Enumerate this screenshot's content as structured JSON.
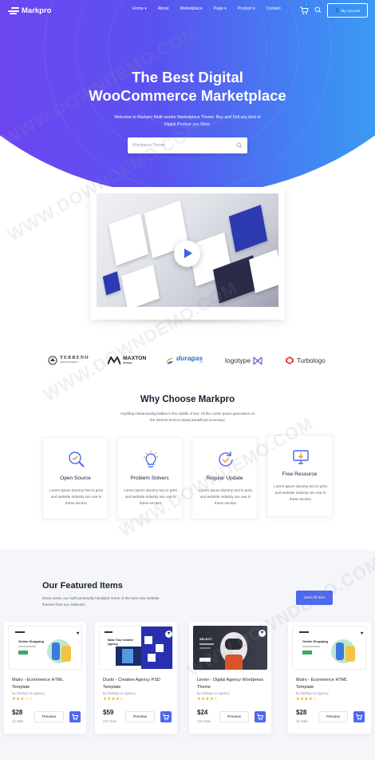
{
  "nav": {
    "logo": "Markpro",
    "menu": [
      "Home",
      "About",
      "Marketplace",
      "Page",
      "Product",
      "Contact"
    ],
    "cart_count": "0",
    "account_label": "My Account"
  },
  "hero": {
    "title_line1": "The Best Digital",
    "title_line2": "WooCommerce Marketplace",
    "subtitle": "Welcome to Markpro Multi vendor Marketplace Theme. Buy and Sell any kind of Digital Product you Wish.",
    "search_placeholder": "Wordpress Theme"
  },
  "brands": [
    "TERRENO",
    "MAXTON",
    "duragas",
    "logotype",
    "Turbologo"
  ],
  "brand_sub": {
    "terreno": "CREATIVE AGENCY",
    "maxton": "design",
    "duragas": "CO"
  },
  "why": {
    "title": "Why Choose Markpro",
    "subtitle": "Anything embarrassing hidden in the middle of text. All the Lorem Ipsum generators on the Internet tend to repeat predefined necessary",
    "features": [
      {
        "title": "Open Source",
        "icon": "search-check-icon",
        "desc": "Lorem ipsum dummy text in print and website industry are use in these section"
      },
      {
        "title": "Problem Solvers",
        "icon": "lightbulb-icon",
        "desc": "Lorem ipsum dummy text in print and website industry are use in these section"
      },
      {
        "title": "Regular Update",
        "icon": "refresh-check-icon",
        "desc": "Lorem ipsum dummy text in print and website industry are use in these section"
      },
      {
        "title": "Free Resource",
        "icon": "monitor-icon",
        "desc": "Lorem ipsum dummy text in print and website industry are use in these section"
      }
    ]
  },
  "featured": {
    "title": "Our Featured Items",
    "subtitle": "Every week, our staff personally handpick some of the best new website themes from our collection",
    "view_all": "View All Item",
    "items": [
      {
        "name": "Malro - Ecommerce HTML Template",
        "by": "by DivDojo in Agency",
        "stars": "★★★☆☆",
        "price": "$28",
        "sales": "12 Sale",
        "preview": "Preview",
        "thumb_title": "Online Shopping"
      },
      {
        "name": "Duxlo - Creative Agency PSD Template",
        "by": "by DivDojo in Agency",
        "stars": "★★★★☆",
        "price": "$59",
        "sales": "247 Sale",
        "preview": "Preview",
        "thumb_title": "Make Your Creative Agency"
      },
      {
        "name": "Linner - Digital Agency Wordpress Theme",
        "by": "by DivDojo in Agency",
        "stars": "★★★★☆",
        "price": "$24",
        "sales": "124 Sale",
        "preview": "Preview",
        "thumb_title": "SELECT"
      },
      {
        "name": "Malro - Ecommerce HTML Template",
        "by": "by DivDojo in Agency",
        "stars": "★★★★☆",
        "price": "$28",
        "sales": "12 Sale",
        "preview": "Preview",
        "thumb_title": "Online Shopping"
      }
    ]
  },
  "watermark": "WWW.DOWNDEMO.COM",
  "colors": {
    "accent": "#4c68f0",
    "gradient_start": "#7b3df2",
    "gradient_end": "#37b8f3",
    "star": "#f5a623"
  }
}
